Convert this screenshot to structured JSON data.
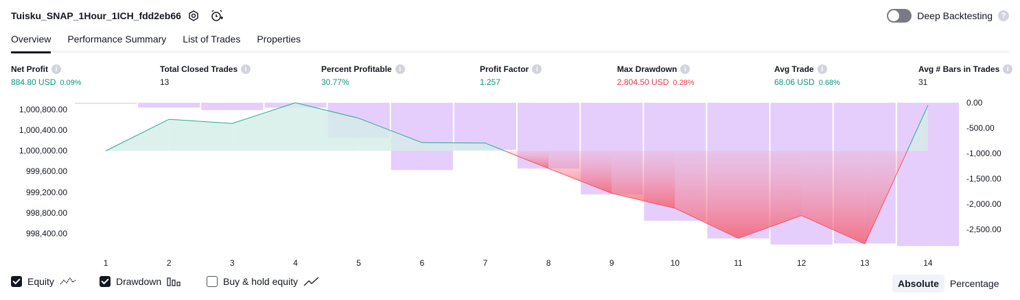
{
  "header": {
    "title": "Tuisku_SNAP_1Hour_1ICH_fdd2eb66",
    "deep_backtesting_label": "Deep Backtesting",
    "deep_backtesting_on": false
  },
  "tabs": [
    {
      "label": "Overview",
      "active": true
    },
    {
      "label": "Performance Summary",
      "active": false
    },
    {
      "label": "List of Trades",
      "active": false
    },
    {
      "label": "Properties",
      "active": false
    }
  ],
  "metrics": [
    {
      "label": "Net Profit",
      "value": "884.80 USD",
      "pct": "0.09%",
      "tone": "pos"
    },
    {
      "label": "Total Closed Trades",
      "value": "13",
      "pct": "",
      "tone": "neu"
    },
    {
      "label": "Percent Profitable",
      "value": "30.77%",
      "pct": "",
      "tone": "pos"
    },
    {
      "label": "Profit Factor",
      "value": "1.257",
      "pct": "",
      "tone": "pos"
    },
    {
      "label": "Max Drawdown",
      "value": "2,804.50 USD",
      "pct": "0.28%",
      "tone": "neg"
    },
    {
      "label": "Avg Trade",
      "value": "68.06 USD",
      "pct": "0.68%",
      "tone": "pos"
    },
    {
      "label": "Avg # Bars in Trades",
      "value": "31",
      "pct": "",
      "tone": "neu"
    }
  ],
  "chart_data": {
    "type": "line",
    "x": [
      1,
      2,
      3,
      4,
      5,
      6,
      7,
      8,
      9,
      10,
      11,
      12,
      13,
      14
    ],
    "series": [
      {
        "name": "Equity",
        "axis": "left",
        "values": [
          1000000,
          1000610,
          1000530,
          1000930,
          1000630,
          1000160,
          1000150,
          999660,
          999180,
          998890,
          998310,
          998750,
          998200,
          1000880
        ]
      },
      {
        "name": "Drawdown",
        "axis": "right",
        "type": "bar",
        "values": [
          -20,
          -95,
          -145,
          -95,
          -700,
          -1330,
          -930,
          -1300,
          -1810,
          -2330,
          -2680,
          -2800,
          -2780,
          -2830
        ]
      }
    ],
    "left_ticks": [
      "1,000,800.00",
      "1,000,400.00",
      "1,000,000.00",
      "999,600.00",
      "999,200.00",
      "998,800.00",
      "998,400.00"
    ],
    "right_ticks": [
      "0.00",
      "-500.00",
      "-1,000.00",
      "-1,500.00",
      "-2,000.00",
      "-2,500.00"
    ],
    "x_ticks": [
      "1",
      "2",
      "3",
      "4",
      "5",
      "6",
      "7",
      "8",
      "9",
      "10",
      "11",
      "12",
      "13",
      "14"
    ],
    "left_range": [
      998150,
      1000930
    ],
    "right_range": [
      -2840,
      0
    ],
    "baseline_equity": 1000000,
    "colors": {
      "equity_up_line": "#22ab94",
      "equity_up_fill": "#d4ede7",
      "equity_down_line": "#f7525f",
      "equity_down_fill": "#f0a0b4",
      "drawdown_bar": "#e0c6fc"
    }
  },
  "legend": {
    "equity": {
      "label": "Equity",
      "checked": true
    },
    "drawdown": {
      "label": "Drawdown",
      "checked": true
    },
    "buyhold": {
      "label": "Buy & hold equity",
      "checked": false
    }
  },
  "mode": {
    "absolute": "Absolute",
    "percentage": "Percentage",
    "selected": "Absolute"
  }
}
